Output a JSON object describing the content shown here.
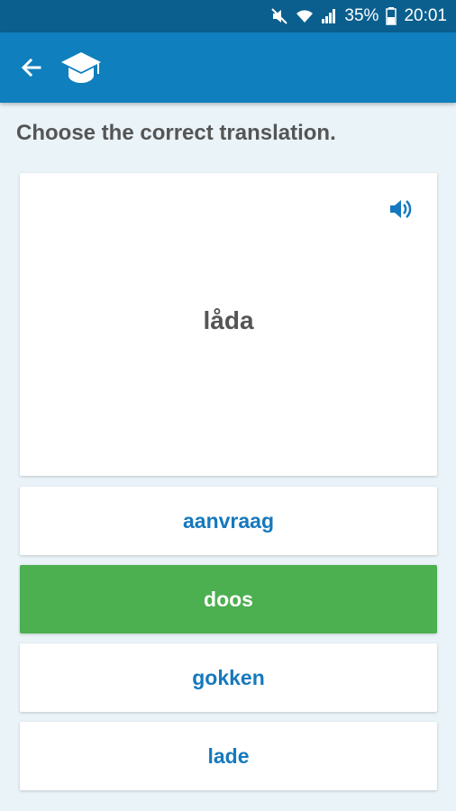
{
  "status_bar": {
    "battery": "35%",
    "time": "20:01",
    "icons": [
      "mute-icon",
      "wifi-icon",
      "signal-icon",
      "battery-icon"
    ]
  },
  "app_bar": {
    "icons": [
      "back-arrow-icon",
      "graduation-cap-icon"
    ],
    "color": "#0f7fbe"
  },
  "quiz": {
    "prompt": "Choose the correct translation.",
    "word": "låda",
    "audio_icon": "speaker-icon",
    "options": [
      {
        "label": "aanvraag",
        "state": "default"
      },
      {
        "label": "doos",
        "state": "selected-correct"
      },
      {
        "label": "gokken",
        "state": "default"
      },
      {
        "label": "lade",
        "state": "default"
      }
    ]
  },
  "colors": {
    "status_bar": "#0b5f8e",
    "accent": "#1679bd",
    "correct": "#4caf50",
    "background": "#e9f3f8"
  }
}
